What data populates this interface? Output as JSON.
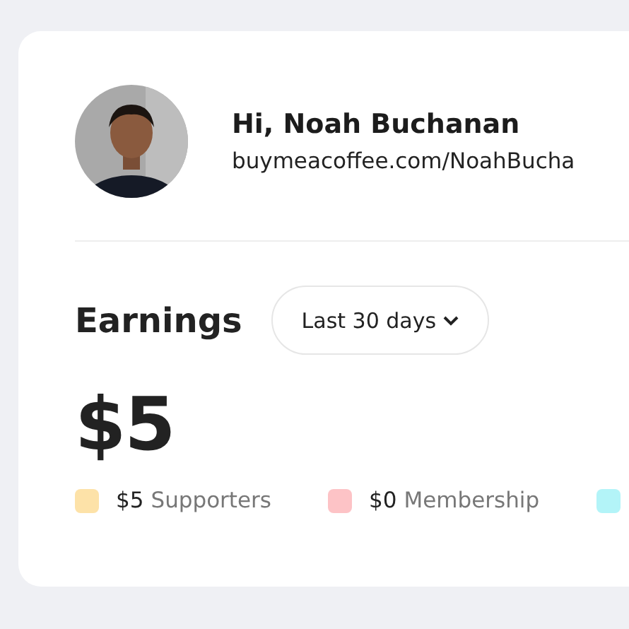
{
  "profile": {
    "greeting": "Hi, Noah Buchanan",
    "url": "buymeacoffee.com/NoahBucha"
  },
  "earnings": {
    "title": "Earnings",
    "period": "Last 30 days",
    "total": "$5",
    "legend": [
      {
        "amount": "$5",
        "label": "Supporters",
        "color": "#fde2a8"
      },
      {
        "amount": "$0",
        "label": "Membership",
        "color": "#fdc3c6"
      },
      {
        "color": "#b3f4f8"
      }
    ]
  }
}
